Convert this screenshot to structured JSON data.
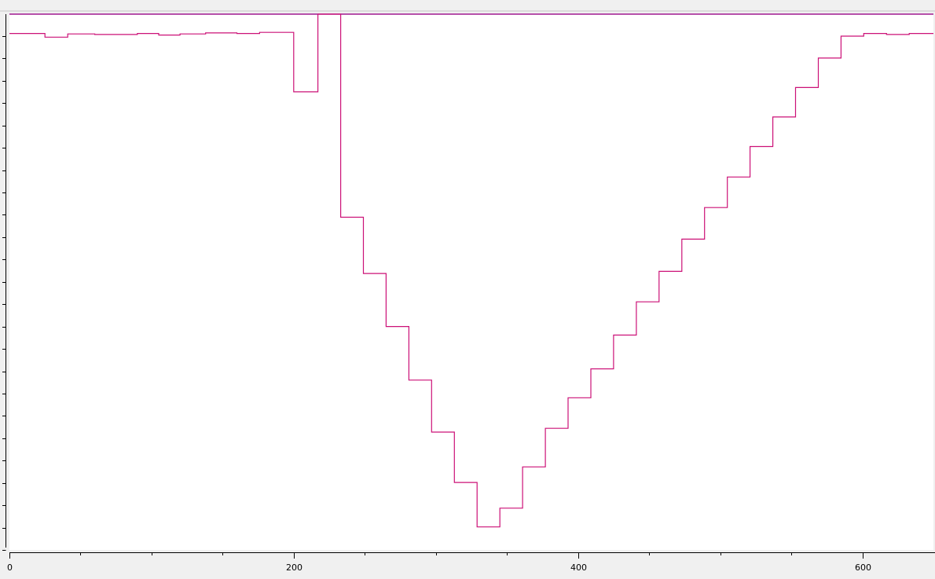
{
  "chart_data": {
    "type": "line",
    "title": "",
    "xlabel": "",
    "ylabel": "",
    "xlim": [
      0,
      650
    ],
    "ylim": [
      0,
      100
    ],
    "x_ticks": [
      {
        "value": 0,
        "label": "0"
      },
      {
        "value": 200,
        "label": "200"
      },
      {
        "value": 400,
        "label": "400"
      },
      {
        "value": 600,
        "label": "600"
      }
    ],
    "x_minor_ticks": [
      50,
      100,
      150,
      250,
      300,
      350,
      450,
      500,
      550
    ],
    "y_tick_count": 24,
    "y_ticks_labeled": false,
    "grid": false,
    "legend": "none",
    "colors": {
      "plot_bg": "#ffffff",
      "frame_bg": "#f0f0f0",
      "series_line": "#cc1177",
      "reference_line": "#a01890",
      "axis": "#000000"
    },
    "reference_line": {
      "y": 100
    },
    "series": [
      {
        "step": true,
        "x": [
          0,
          25,
          41,
          60,
          80,
          90,
          105,
          120,
          138,
          160,
          176,
          200,
          217,
          233,
          249,
          265,
          281,
          297,
          313,
          329,
          345,
          361,
          377,
          393,
          409,
          425,
          441,
          457,
          473,
          489,
          505,
          521,
          537,
          553,
          569,
          585,
          601,
          617,
          633,
          650
        ],
        "y": [
          96.4,
          95.7,
          96.3,
          96.2,
          96.2,
          96.4,
          96.1,
          96.3,
          96.5,
          96.4,
          96.6,
          85.5,
          100,
          62.1,
          51.6,
          41.7,
          31.7,
          22.0,
          12.6,
          4.3,
          7.8,
          15.5,
          22.7,
          28.4,
          33.8,
          40.1,
          46.3,
          52.0,
          58.0,
          63.9,
          69.6,
          75.3,
          80.8,
          86.3,
          91.8,
          95.9,
          96.4,
          96.2,
          96.4,
          96.4
        ]
      }
    ]
  }
}
